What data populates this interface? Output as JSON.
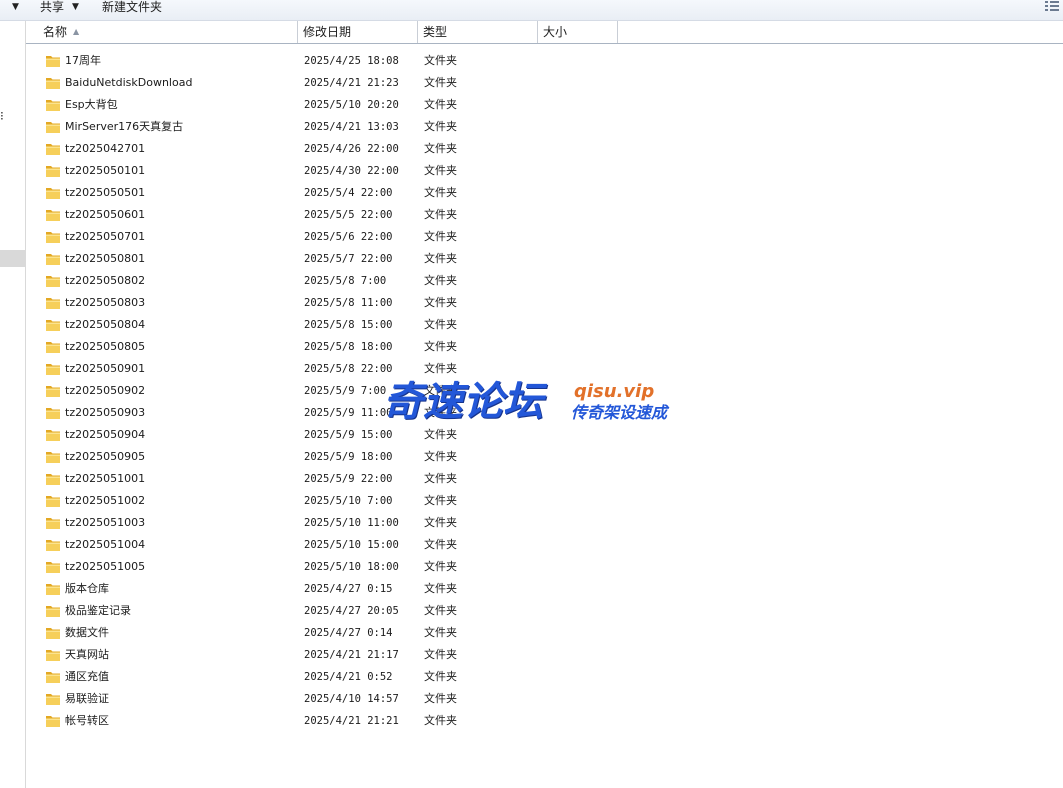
{
  "toolbar": {
    "share_label": "共享",
    "new_folder_label": "新建文件夹"
  },
  "columns": {
    "name": "名称",
    "date": "修改日期",
    "type": "类型",
    "size": "大小"
  },
  "files": [
    {
      "name": "17周年",
      "date": "2025/4/25 18:08",
      "type": "文件夹"
    },
    {
      "name": "BaiduNetdiskDownload",
      "date": "2025/4/21 21:23",
      "type": "文件夹"
    },
    {
      "name": "Esp大背包",
      "date": "2025/5/10 20:20",
      "type": "文件夹"
    },
    {
      "name": "MirServer176天真复古",
      "date": "2025/4/21 13:03",
      "type": "文件夹"
    },
    {
      "name": "tz2025042701",
      "date": "2025/4/26 22:00",
      "type": "文件夹"
    },
    {
      "name": "tz2025050101",
      "date": "2025/4/30 22:00",
      "type": "文件夹"
    },
    {
      "name": "tz2025050501",
      "date": "2025/5/4 22:00",
      "type": "文件夹"
    },
    {
      "name": "tz2025050601",
      "date": "2025/5/5 22:00",
      "type": "文件夹"
    },
    {
      "name": "tz2025050701",
      "date": "2025/5/6 22:00",
      "type": "文件夹"
    },
    {
      "name": "tz2025050801",
      "date": "2025/5/7 22:00",
      "type": "文件夹"
    },
    {
      "name": "tz2025050802",
      "date": "2025/5/8 7:00",
      "type": "文件夹"
    },
    {
      "name": "tz2025050803",
      "date": "2025/5/8 11:00",
      "type": "文件夹"
    },
    {
      "name": "tz2025050804",
      "date": "2025/5/8 15:00",
      "type": "文件夹"
    },
    {
      "name": "tz2025050805",
      "date": "2025/5/8 18:00",
      "type": "文件夹"
    },
    {
      "name": "tz2025050901",
      "date": "2025/5/8 22:00",
      "type": "文件夹"
    },
    {
      "name": "tz2025050902",
      "date": "2025/5/9 7:00",
      "type": "文件夹"
    },
    {
      "name": "tz2025050903",
      "date": "2025/5/9 11:00",
      "type": "文件夹"
    },
    {
      "name": "tz2025050904",
      "date": "2025/5/9 15:00",
      "type": "文件夹"
    },
    {
      "name": "tz2025050905",
      "date": "2025/5/9 18:00",
      "type": "文件夹"
    },
    {
      "name": "tz2025051001",
      "date": "2025/5/9 22:00",
      "type": "文件夹"
    },
    {
      "name": "tz2025051002",
      "date": "2025/5/10 7:00",
      "type": "文件夹"
    },
    {
      "name": "tz2025051003",
      "date": "2025/5/10 11:00",
      "type": "文件夹"
    },
    {
      "name": "tz2025051004",
      "date": "2025/5/10 15:00",
      "type": "文件夹"
    },
    {
      "name": "tz2025051005",
      "date": "2025/5/10 18:00",
      "type": "文件夹"
    },
    {
      "name": "版本仓库",
      "date": "2025/4/27 0:15",
      "type": "文件夹"
    },
    {
      "name": "极品鉴定记录",
      "date": "2025/4/27 20:05",
      "type": "文件夹"
    },
    {
      "name": "数据文件",
      "date": "2025/4/27 0:14",
      "type": "文件夹"
    },
    {
      "name": "天真网站",
      "date": "2025/4/21 21:17",
      "type": "文件夹"
    },
    {
      "name": "通区充值",
      "date": "2025/4/21 0:52",
      "type": "文件夹"
    },
    {
      "name": "易联验证",
      "date": "2025/4/10 14:57",
      "type": "文件夹"
    },
    {
      "name": "帐号转区",
      "date": "2025/4/21 21:21",
      "type": "文件夹"
    }
  ],
  "watermark": {
    "main": "奇速论坛",
    "site": "qisu.vip",
    "sub": "传奇架设速成"
  },
  "colors": {
    "folder": "#f0c24a",
    "watermark_blue": "#2357d8",
    "watermark_orange": "#e2712a"
  },
  "icons": {
    "folder": "folder-icon",
    "view": "view-options-icon",
    "sort": "sort-ascending-icon"
  }
}
